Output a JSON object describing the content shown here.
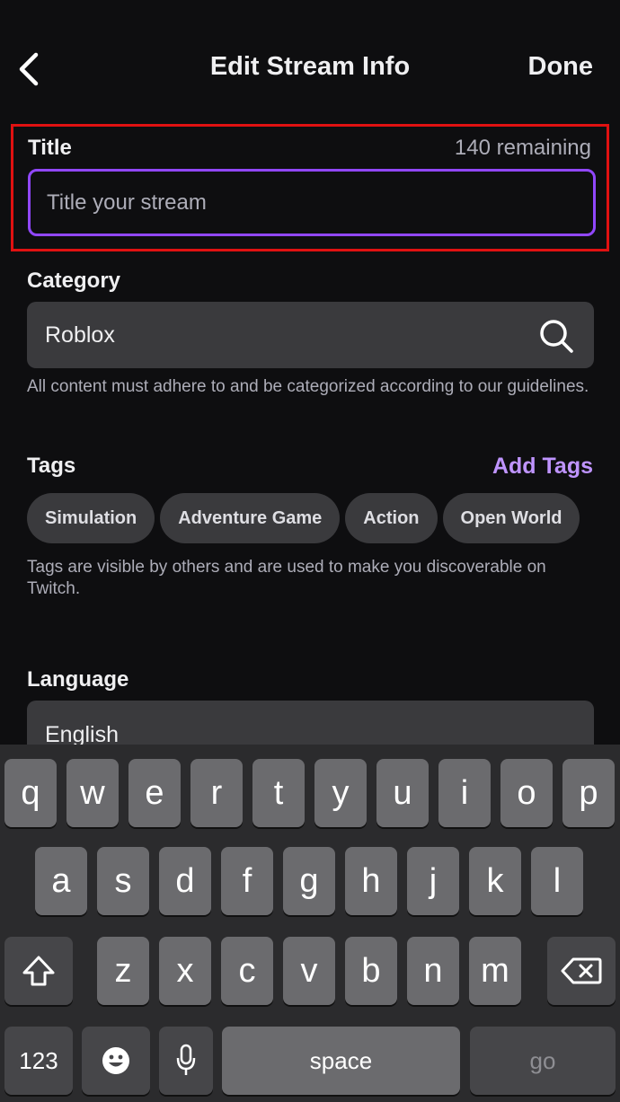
{
  "header": {
    "title": "Edit Stream Info",
    "done_label": "Done"
  },
  "title_field": {
    "label": "Title",
    "remaining": "140 remaining",
    "placeholder": "Title your stream"
  },
  "category": {
    "label": "Category",
    "value": "Roblox",
    "helper": "All content must adhere to and be categorized according to our guidelines."
  },
  "tags": {
    "label": "Tags",
    "add_label": "Add Tags",
    "items": [
      "Simulation",
      "Adventure Game",
      "Action",
      "Open World"
    ],
    "helper": "Tags are visible by others and are used to make you discoverable on Twitch."
  },
  "language": {
    "label": "Language",
    "value": "English"
  },
  "keyboard": {
    "row1": [
      "q",
      "w",
      "e",
      "r",
      "t",
      "y",
      "u",
      "i",
      "o",
      "p"
    ],
    "row2": [
      "a",
      "s",
      "d",
      "f",
      "g",
      "h",
      "j",
      "k",
      "l"
    ],
    "row3": [
      "z",
      "x",
      "c",
      "v",
      "b",
      "n",
      "m"
    ],
    "numbers_label": "123",
    "space_label": "space",
    "go_label": "go"
  },
  "colors": {
    "accent": "#9147ff",
    "link": "#bf94ff",
    "highlight": "#e01111",
    "background": "#0e0e10"
  },
  "icons": [
    "chevron-left-icon",
    "search-icon",
    "shift-icon",
    "delete-icon",
    "emoji-icon",
    "microphone-icon"
  ]
}
